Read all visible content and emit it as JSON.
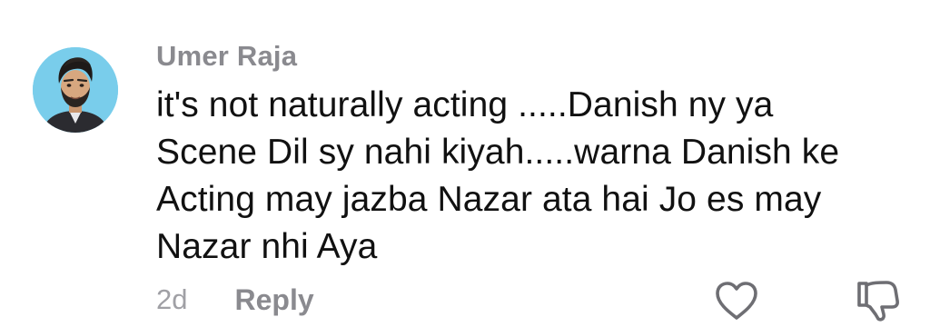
{
  "comment": {
    "username": "Umer Raja",
    "text": "it's not naturally acting .....Danish ny ya\nScene Dil sy nahi kiyah.....warna Danish ke\nActing may jazba Nazar ata hai Jo es may\nNazar nhi Aya",
    "timestamp": "2d",
    "reply_label": "Reply",
    "avatar": "user-profile-photo"
  },
  "icons": {
    "like": "heart-outline-icon",
    "dislike": "thumbs-down-outline-icon"
  },
  "colors": {
    "username": "#8a8a8f",
    "text": "#111111",
    "timestamp": "#a0a0a5",
    "avatar_background": "#79cdeb"
  }
}
